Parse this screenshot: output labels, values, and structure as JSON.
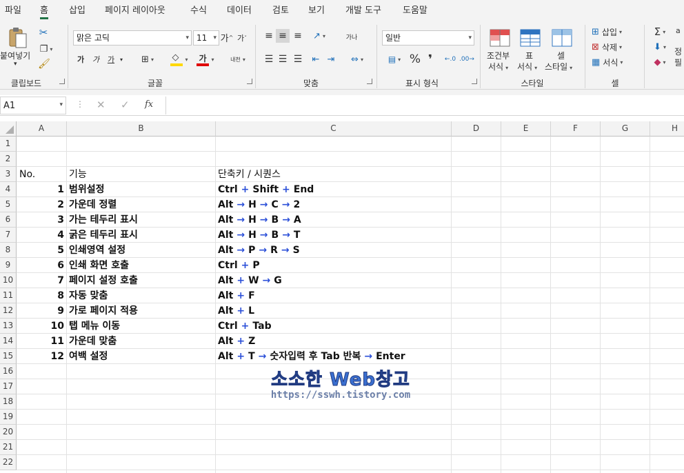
{
  "menu": {
    "tabs": [
      "파일",
      "홈",
      "삽입",
      "페이지 레이아웃",
      "수식",
      "데이터",
      "검토",
      "보기",
      "개발 도구",
      "도움말"
    ],
    "active": "홈"
  },
  "ribbon": {
    "clipboard": {
      "label": "클립보드",
      "paste": "붙여넣기"
    },
    "font": {
      "label": "글꼴",
      "font_name": "맑은 고딕",
      "font_size": "11",
      "grow": "가",
      "shrink": "가",
      "bold": "가",
      "italic": "가",
      "underline": "가",
      "phonetic": "내천",
      "accent_fill": "#ffd800",
      "accent_font": "#e00000"
    },
    "alignment": {
      "label": "맞춤",
      "wrap": "가나"
    },
    "number": {
      "label": "표시 형식",
      "format": "일반",
      "percent": "%",
      "comma": "❜"
    },
    "styles": {
      "label": "스타일",
      "cond": [
        "조건부",
        "서식"
      ],
      "table": [
        "표",
        "서식"
      ],
      "cell": [
        "셀",
        "스타일"
      ]
    },
    "cells": {
      "label": "셀",
      "insert": "삽입",
      "delete": "삭제",
      "format": "서식"
    },
    "editing": {
      "sum": "Σ",
      "sort_label": "정",
      "fill_label": "필",
      "extra": "a"
    }
  },
  "formula_bar": {
    "name_box": "A1",
    "fx": "fx",
    "content": ""
  },
  "columns": [
    "A",
    "B",
    "C",
    "D",
    "E",
    "F",
    "G",
    "H"
  ],
  "rows": [
    "1",
    "2",
    "3",
    "4",
    "5",
    "6",
    "7",
    "8",
    "9",
    "10",
    "11",
    "12",
    "13",
    "14",
    "15",
    "16",
    "17",
    "18",
    "19",
    "20",
    "21",
    "22"
  ],
  "table": {
    "headers": {
      "a": "No.",
      "b": "기능",
      "c": "단축키 / 시퀀스"
    },
    "rows": [
      {
        "no": "1",
        "func": "범위설정",
        "keys": [
          "Ctrl",
          "+",
          "Shift",
          "+",
          "End"
        ]
      },
      {
        "no": "2",
        "func": "가운데 정렬",
        "keys": [
          "Alt",
          "→",
          "H",
          "→",
          "C",
          "→",
          "2"
        ]
      },
      {
        "no": "3",
        "func": "가는 테두리 표시",
        "keys": [
          "Alt",
          "→",
          "H",
          "→",
          "B",
          "→",
          "A"
        ]
      },
      {
        "no": "4",
        "func": "굵은 테두리 표시",
        "keys": [
          "Alt",
          "→",
          "H",
          "→",
          "B",
          "→",
          "T"
        ]
      },
      {
        "no": "5",
        "func": "인쇄영역 설정",
        "keys": [
          "Alt",
          "→",
          "P",
          "→",
          "R",
          "→",
          "S"
        ]
      },
      {
        "no": "6",
        "func": "인쇄 화면 호출",
        "keys": [
          "Ctrl",
          "+",
          "P"
        ]
      },
      {
        "no": "7",
        "func": "페이지 설정 호출",
        "keys": [
          "Alt",
          "+",
          "W",
          "→",
          "G"
        ]
      },
      {
        "no": "8",
        "func": "자동 맞춤",
        "keys": [
          "Alt",
          "+",
          "F"
        ]
      },
      {
        "no": "9",
        "func": "가로 페이지 적용",
        "keys": [
          "Alt",
          "+",
          "L"
        ]
      },
      {
        "no": "10",
        "func": "탭 메뉴 이동",
        "keys": [
          "Ctrl",
          "+",
          "Tab"
        ]
      },
      {
        "no": "11",
        "func": "가운데 맞춤",
        "keys": [
          "Alt",
          "+",
          "Z"
        ]
      },
      {
        "no": "12",
        "func": "여백 설정",
        "keys": [
          "Alt",
          "+",
          "T",
          "→",
          "숫자입력 후 Tab 반복",
          "→",
          "Enter"
        ]
      }
    ]
  },
  "watermark": {
    "title": "소소한 Web창고",
    "url": "https://sswh.tistory.com"
  }
}
